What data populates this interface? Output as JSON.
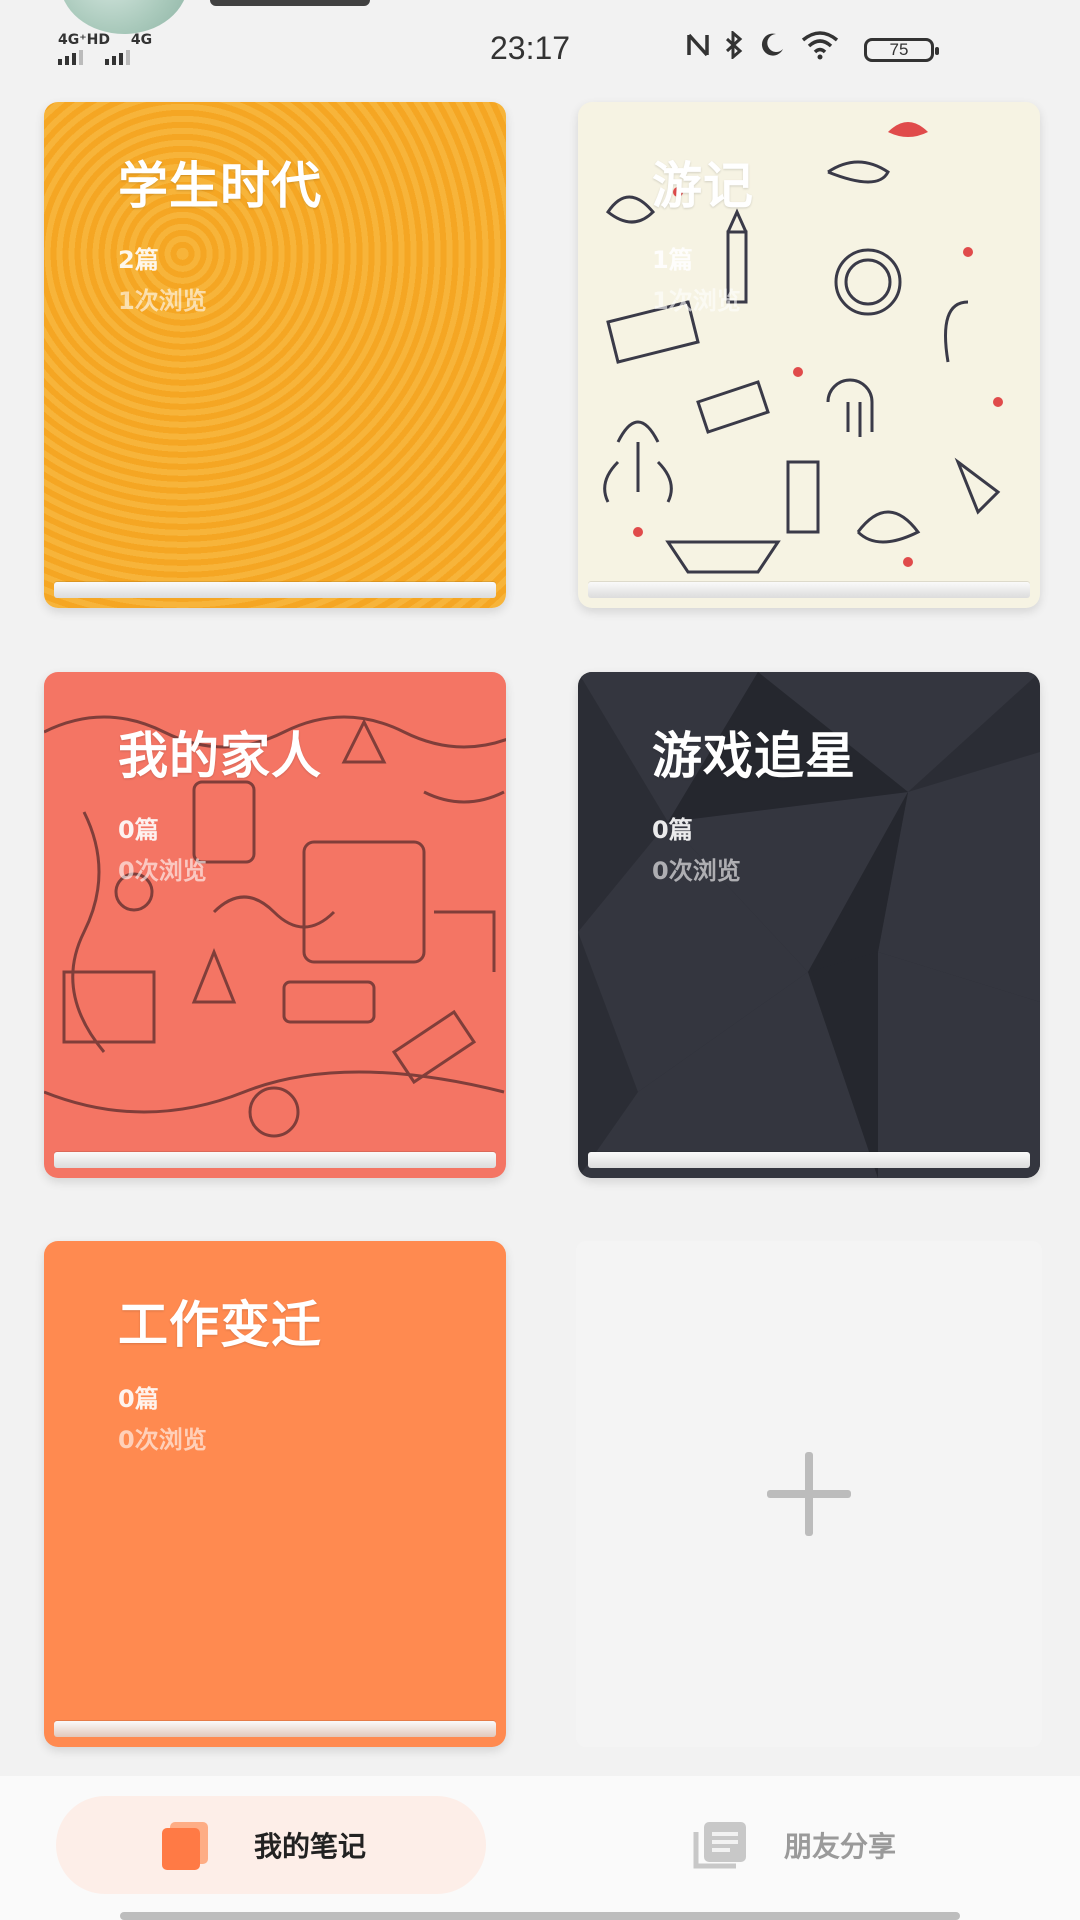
{
  "status_bar": {
    "network_left": "4G⁺HD",
    "network_right": "4G",
    "time": "23:17",
    "battery": "75"
  },
  "notebooks": [
    {
      "title": "学生时代",
      "articles": "2篇",
      "views": "1次浏览",
      "theme": "#f5a623"
    },
    {
      "title": "游记",
      "articles": "1篇",
      "views": "1次浏览",
      "theme": "#f6f3e3"
    },
    {
      "title": "我的家人",
      "articles": "0篇",
      "views": "0次浏览",
      "theme": "#f47564"
    },
    {
      "title": "游戏追星",
      "articles": "0篇",
      "views": "0次浏览",
      "theme": "#2b2d35"
    },
    {
      "title": "工作变迁",
      "articles": "0篇",
      "views": "0次浏览",
      "theme": "#ff8a50"
    }
  ],
  "add_card": {
    "icon": "plus-icon"
  },
  "tabs": [
    {
      "label": "我的笔记",
      "icon": "notebook-stack-icon",
      "active": true
    },
    {
      "label": "朋友分享",
      "icon": "shared-notes-icon",
      "active": false
    }
  ],
  "colors": {
    "accent": "#ff7a45",
    "background": "#f2f2f2"
  }
}
